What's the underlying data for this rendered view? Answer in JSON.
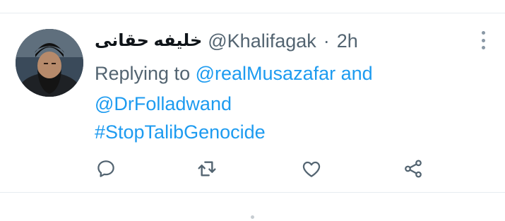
{
  "tweet": {
    "display_name": "خليفه حقانى",
    "handle": "@Khalifagak",
    "separator": "·",
    "time": "2h",
    "replying": {
      "prefix": "Replying to",
      "mention_1": "@realMusazafar",
      "connector": "and",
      "mention_2": "@DrFolladwand"
    },
    "text": "#StopTalibGenocide",
    "avatar_icon": "profile-photo",
    "more_icon": "vertical-ellipsis-icon"
  },
  "actions": [
    {
      "name": "reply",
      "icon": "comment-bubble-icon"
    },
    {
      "name": "retweet",
      "icon": "retweet-arrows-icon"
    },
    {
      "name": "like",
      "icon": "heart-icon"
    },
    {
      "name": "share",
      "icon": "share-nodes-icon"
    }
  ],
  "colors": {
    "link": "#1d9bf0",
    "secondary_text": "#536471",
    "primary_text": "#0f1419",
    "icon": "#536471",
    "divider": "#e6ecf0"
  }
}
